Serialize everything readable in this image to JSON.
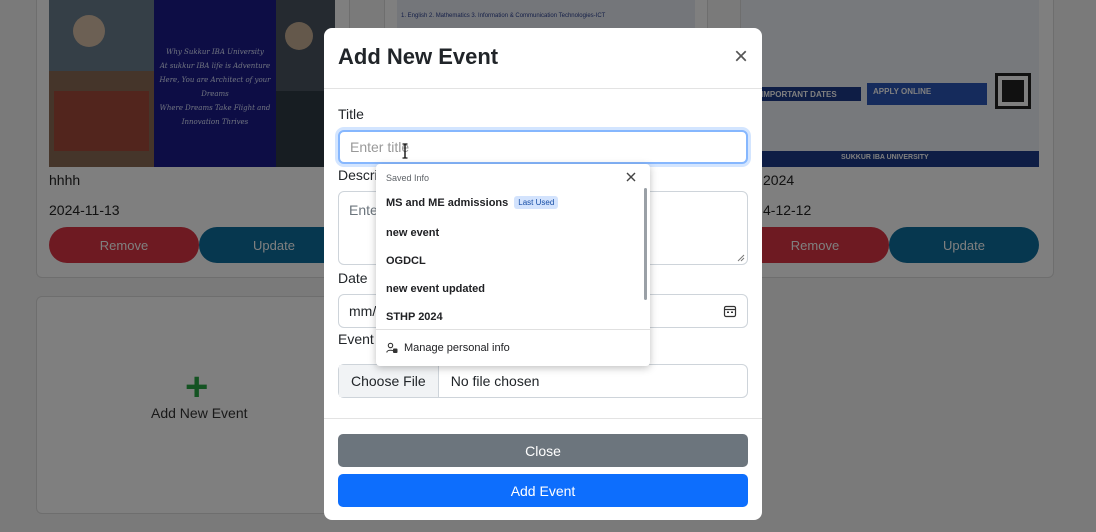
{
  "background": {
    "cards": [
      {
        "title": "hhhh",
        "date": "2024-11-13",
        "remove_label": "Remove",
        "update_label": "Update"
      },
      {
        "title": "2024",
        "date": "4-12-12",
        "remove_label": "Remove",
        "update_label": "Update"
      }
    ],
    "add_card": {
      "plus": "+",
      "label": "Add New Event"
    },
    "poster_text": {
      "banner_line1": "Why Sukkur IBA University",
      "banner_line2": "At sukkur IBA life is Adventure",
      "banner_line3": "Here, You are Architect of your Dreams",
      "banner_line4": "Where Dreams Take Flight and Innovation Thrives",
      "right_important": "IMPORTANT DATES",
      "right_apply": "APPLY ONLINE",
      "right_footer": "SUKKUR IBA UNIVERSITY",
      "middle_line": "1. English   2. Mathematics   3. Information & Communication Technologies-ICT"
    }
  },
  "modal": {
    "title": "Add New Event",
    "close_icon": "×",
    "fields": {
      "title_label": "Title",
      "title_placeholder": "Enter title",
      "description_label": "Description",
      "description_placeholder": "Enter description",
      "date_label": "Date",
      "date_placeholder": "mm/dd/yyyy",
      "event_label": "Event Image",
      "file_button": "Choose File",
      "file_text": "No file chosen"
    },
    "buttons": {
      "close": "Close",
      "add_event": "Add Event"
    }
  },
  "autofill": {
    "header": "Saved Info",
    "items": [
      {
        "label": "MS and ME admissions",
        "badge": "Last Used"
      },
      {
        "label": "new event"
      },
      {
        "label": "OGDCL"
      },
      {
        "label": "new event updated"
      },
      {
        "label": "STHP 2024"
      }
    ],
    "manage_label": "Manage personal info"
  },
  "colors": {
    "remove": "#dc3545",
    "update": "#0d6e9e",
    "primary": "#0d6efd",
    "secondary": "#6c757d",
    "add_green": "#28a745"
  },
  "icons": {
    "calendar": "calendar-icon",
    "close": "close-icon",
    "manage": "manage-info-icon",
    "plus": "plus-icon"
  }
}
